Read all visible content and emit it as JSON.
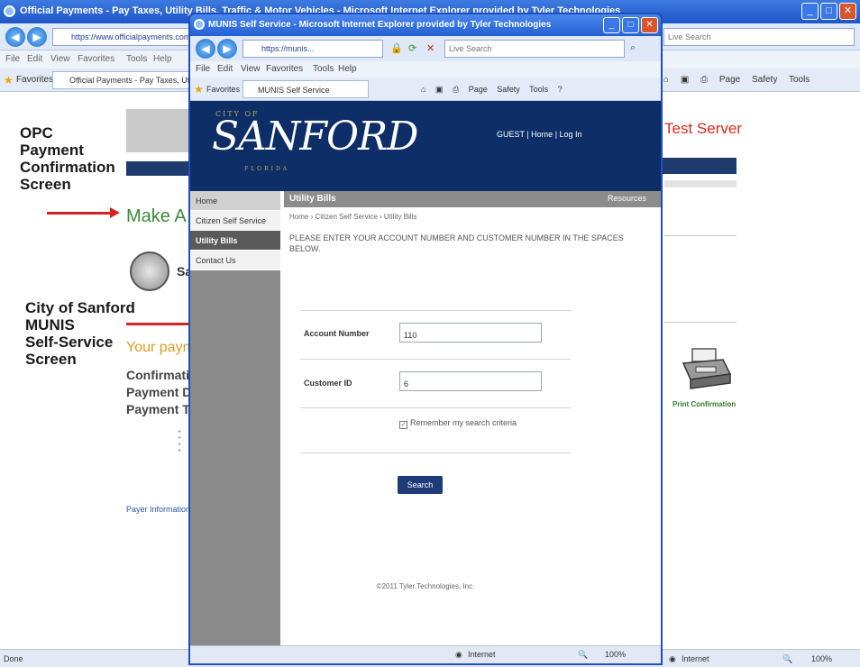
{
  "back_window": {
    "title": "Official Payments - Pay Taxes, Utility Bills, Traffic & Motor Vehicles - Microsoft Internet Explorer provided by Tyler Technologies",
    "address": "https://www.officialpayments.com/...",
    "search_placeholder": "Live Search",
    "menu": [
      "File",
      "Edit",
      "View",
      "Favorites",
      "Tools",
      "Help"
    ],
    "favorites_label": "Favorites",
    "tab_label": "Official Payments - Pay Taxes, Utility...",
    "tools": [
      "Page",
      "Safety",
      "Tools"
    ],
    "test_server": "Test Server",
    "make_a": "Make A P",
    "seal_text": "Sa",
    "your_payment": "Your paym",
    "confirmation_lines": [
      "Confirmati",
      "Payment D",
      "Payment T"
    ],
    "payer_info": "Payer Information",
    "print_label": "Print Confirmation",
    "status_left": "Done",
    "status_zone": "Internet",
    "status_zoom": "100%"
  },
  "annotations": {
    "opc": "OPC\nPayment\nConfirmation\nScreen",
    "city": "City of Sanford\nMUNIS\nSelf-Service\nScreen"
  },
  "front_window": {
    "title": "MUNIS Self Service - Microsoft Internet Explorer provided by Tyler Technologies",
    "address": "https://munis...",
    "search_placeholder": "Live Search",
    "menu": [
      "File",
      "Edit",
      "View",
      "Favorites",
      "Tools",
      "Help"
    ],
    "favorites_label": "Favorites",
    "tab_label": "MUNIS Self Service",
    "tools": [
      "Page",
      "Safety",
      "Tools"
    ],
    "status_zone": "Internet",
    "status_zoom": "100%"
  },
  "munis": {
    "logo_city": "CITY OF",
    "logo_main": "SANFORD",
    "logo_sub": "FLORIDA",
    "header_links": "GUEST | Home | Log In",
    "sidebar": [
      "Home",
      "Citizen Self Service",
      "Utility Bills",
      "Contact Us"
    ],
    "section_title": "Utility Bills",
    "resources": "Resources",
    "breadcrumb": "Home › Citizen Self Service › Utility Bills",
    "instructions": "PLEASE ENTER YOUR ACCOUNT NUMBER AND CUSTOMER NUMBER IN THE SPACES BELOW.",
    "account_label": "Account Number",
    "account_value": "110",
    "customer_label": "Customer ID",
    "customer_value": "6",
    "remember_label": "Remember my search criteria",
    "search_button": "Search",
    "copyright": "©2011 Tyler Technologies, Inc."
  }
}
